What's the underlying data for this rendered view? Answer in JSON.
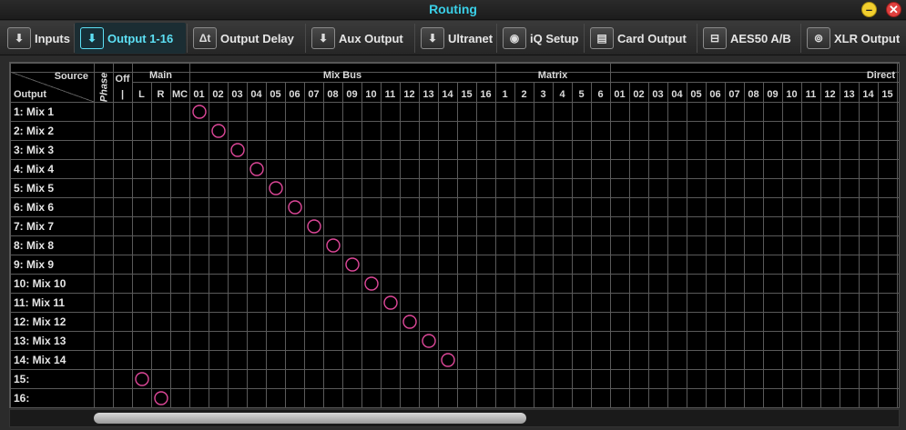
{
  "window": {
    "title": "Routing",
    "minimize_icon": "minus-icon",
    "close_icon": "close-icon"
  },
  "tabs": [
    {
      "label": "Inputs",
      "icon": "input-jack-icon",
      "glyph": "⬇",
      "active": false
    },
    {
      "label": "Output 1-16",
      "icon": "output-jack-icon",
      "glyph": "⬇",
      "active": true
    },
    {
      "label": "Output Delay",
      "icon": "delta-t-icon",
      "glyph": "Δt",
      "active": false
    },
    {
      "label": "Aux Output",
      "icon": "output-jack-icon",
      "glyph": "⬇",
      "active": false
    },
    {
      "label": "Ultranet",
      "icon": "output-jack-icon",
      "glyph": "⬇",
      "active": false
    },
    {
      "label": "iQ Setup",
      "icon": "speaker-icon",
      "glyph": "◉",
      "active": false
    },
    {
      "label": "Card Output",
      "icon": "card-icon",
      "glyph": "▤",
      "active": false
    },
    {
      "label": "AES50 A/B",
      "icon": "aes-connector-icon",
      "glyph": "⊟",
      "active": false
    },
    {
      "label": "XLR Output",
      "icon": "xlr-connector-icon",
      "glyph": "⊚",
      "active": false
    }
  ],
  "grid": {
    "corner_source": "Source",
    "corner_output": "Output",
    "phase_label": "Phase",
    "off_label": "Off",
    "off_sub": "|",
    "main_label": "Main",
    "main_subs": [
      "L",
      "R",
      "MC"
    ],
    "mixbus_label": "Mix Bus",
    "mixbus_subs": [
      "01",
      "02",
      "03",
      "04",
      "05",
      "06",
      "07",
      "08",
      "09",
      "10",
      "11",
      "12",
      "13",
      "14",
      "15",
      "16"
    ],
    "matrix_label": "Matrix",
    "matrix_subs": [
      "1",
      "2",
      "3",
      "4",
      "5",
      "6"
    ],
    "direct_label": "Direct",
    "direct_subs": [
      "01",
      "02",
      "03",
      "04",
      "05",
      "06",
      "07",
      "08",
      "09",
      "10",
      "11",
      "12",
      "13",
      "14",
      "15"
    ],
    "rows": [
      {
        "label": "1: Mix 1",
        "routed": "Mix Bus 01"
      },
      {
        "label": "2: Mix 2",
        "routed": "Mix Bus 02"
      },
      {
        "label": "3: Mix 3",
        "routed": "Mix Bus 03"
      },
      {
        "label": "4: Mix 4",
        "routed": "Mix Bus 04"
      },
      {
        "label": "5: Mix 5",
        "routed": "Mix Bus 05"
      },
      {
        "label": "6: Mix 6",
        "routed": "Mix Bus 06"
      },
      {
        "label": "7: Mix 7",
        "routed": "Mix Bus 07"
      },
      {
        "label": "8: Mix 8",
        "routed": "Mix Bus 08"
      },
      {
        "label": "9: Mix 9",
        "routed": "Mix Bus 09"
      },
      {
        "label": "10: Mix 10",
        "routed": "Mix Bus 10"
      },
      {
        "label": "11: Mix 11",
        "routed": "Mix Bus 11"
      },
      {
        "label": "12: Mix 12",
        "routed": "Mix Bus 12"
      },
      {
        "label": "13: Mix 13",
        "routed": "Mix Bus 13"
      },
      {
        "label": "14: Mix 14",
        "routed": "Mix Bus 14"
      },
      {
        "label": "15:",
        "routed": "Main L"
      },
      {
        "label": "16:",
        "routed": "Main R"
      }
    ]
  },
  "colors": {
    "accent": "#5de0f5",
    "route_marker": "#e0489a",
    "grid_line": "#5a5a5a"
  }
}
